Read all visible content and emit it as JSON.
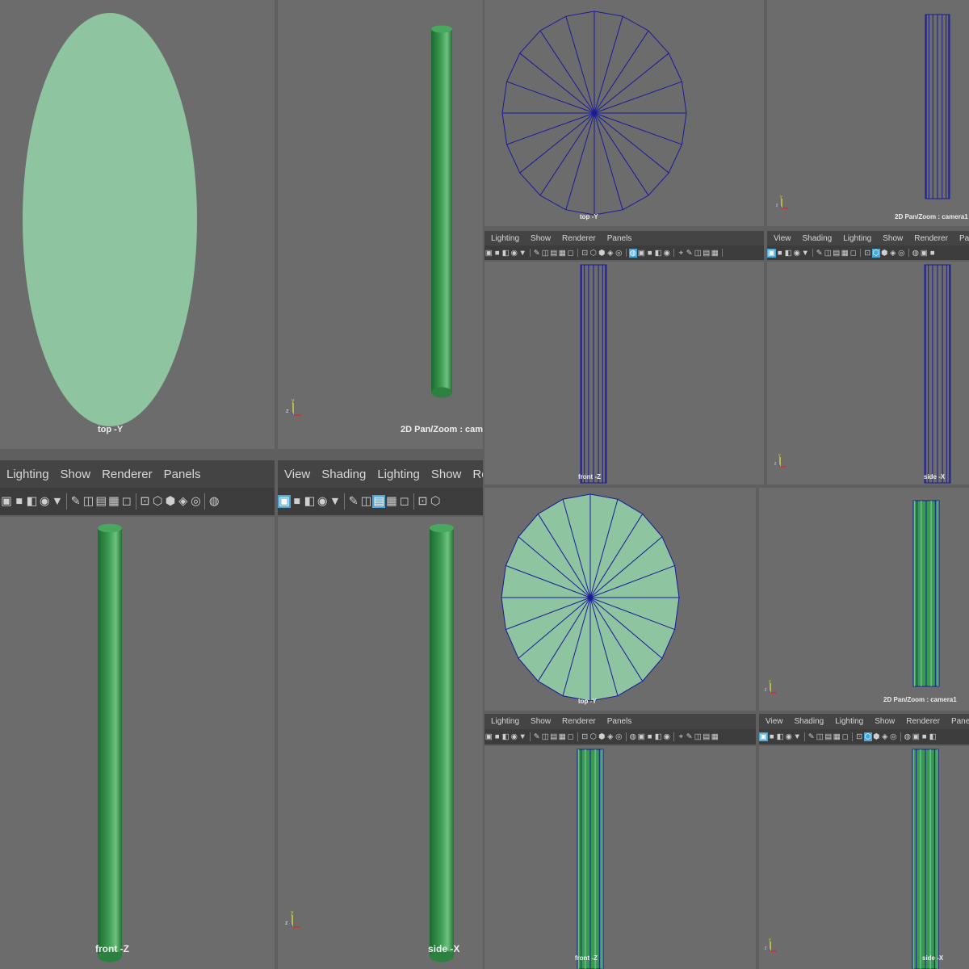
{
  "menus": {
    "set_a": [
      "Lighting",
      "Show",
      "Renderer",
      "Panels"
    ],
    "set_b": [
      "View",
      "Shading",
      "Lighting",
      "Show",
      "Renderer",
      "Panels"
    ]
  },
  "labels": {
    "top": "top -Y",
    "front": "front -Z",
    "side": "side -X",
    "persp": "2D Pan/Zoom : camera1"
  },
  "axis": {
    "x": "x",
    "y": "y",
    "z": "z"
  },
  "toolbar_icons": [
    "camera-icon",
    "bookmark-icon",
    "grid-icon",
    "film-gate-icon",
    "resolution-gate-icon",
    "wireframe-icon",
    "smooth-shade-icon",
    "texture-icon",
    "light-icon",
    "isolate-icon"
  ],
  "colors": {
    "viewport_bg": "#6c6c6c",
    "toolbar_bg": "#444444",
    "mesh_fill": "#8ec4a0",
    "cylinder_green": "#3a9a52",
    "wire_blue": "#1a1a9a",
    "axis_x": "#d03030",
    "axis_y": "#d0d040",
    "axis_z": "#3060d0",
    "highlight": "#4aa8d8"
  }
}
